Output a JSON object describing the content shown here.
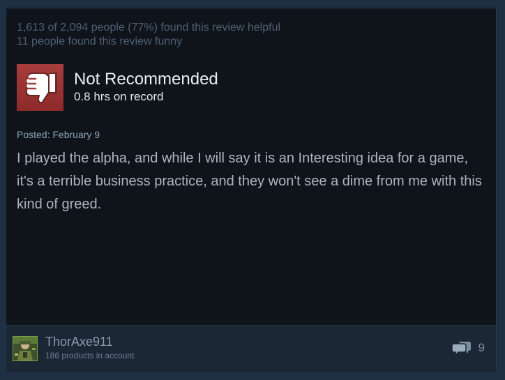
{
  "review": {
    "helpful_text": "1,613 of 2,094 people (77%) found this review helpful",
    "funny_text": "11 people found this review funny",
    "verdict": "Not Recommended",
    "hours": "0.8 hrs on record",
    "posted": "Posted: February 9",
    "body": "I played the alpha, and while I will say it is an Interesting idea for a game, it's a terrible business practice, and they won't see a dime from me with this kind of greed.",
    "verdict_icon": "thumbs-down-icon"
  },
  "author": {
    "username": "ThorAxe911",
    "products": "186 products in account"
  },
  "comments": {
    "count": "9",
    "icon": "comment-bubbles-icon"
  },
  "colors": {
    "background": "#1b2838",
    "card": "#0f141b",
    "thumb_box": "#a33b3b",
    "footer": "#1c2736"
  }
}
